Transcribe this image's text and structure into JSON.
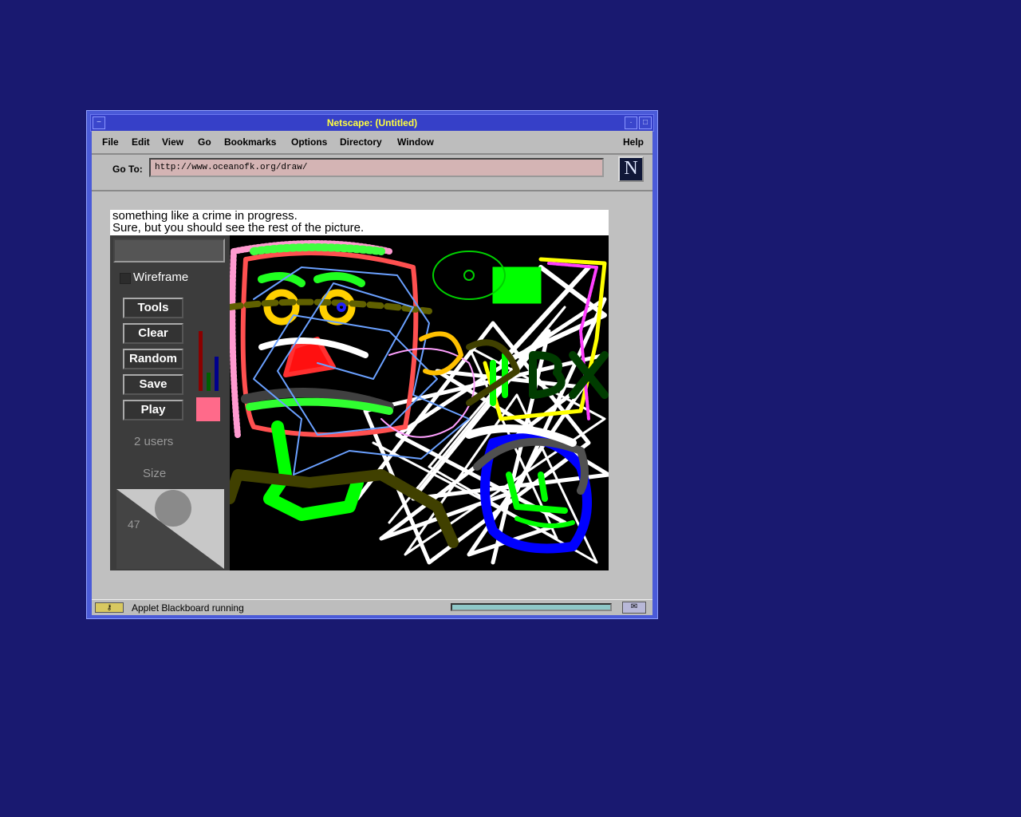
{
  "window": {
    "title": "Netscape:  (Untitled)"
  },
  "menu": {
    "items": [
      "File",
      "Edit",
      "View",
      "Go",
      "Bookmarks",
      "Options",
      "Directory",
      "Window"
    ],
    "help": "Help"
  },
  "location": {
    "label": "Go To:",
    "url": "http://www.oceanofk.org/draw/"
  },
  "logo": {
    "letter": "N"
  },
  "page": {
    "caption_line1": "something like a crime in progress.",
    "caption_line2": "Sure, but you should see the rest of the picture."
  },
  "applet": {
    "wireframe_label": "Wireframe",
    "buttons": {
      "tools": "Tools",
      "clear": "Clear",
      "random": "Random",
      "save": "Save",
      "play": "Play"
    },
    "users": "2 users",
    "size_label": "Size",
    "size_value": "47",
    "color": {
      "red": 0.75,
      "green": 0.23,
      "blue": 0.43,
      "swatch": "#ff6a8a"
    }
  },
  "status": {
    "text": "Applet Blackboard running"
  }
}
